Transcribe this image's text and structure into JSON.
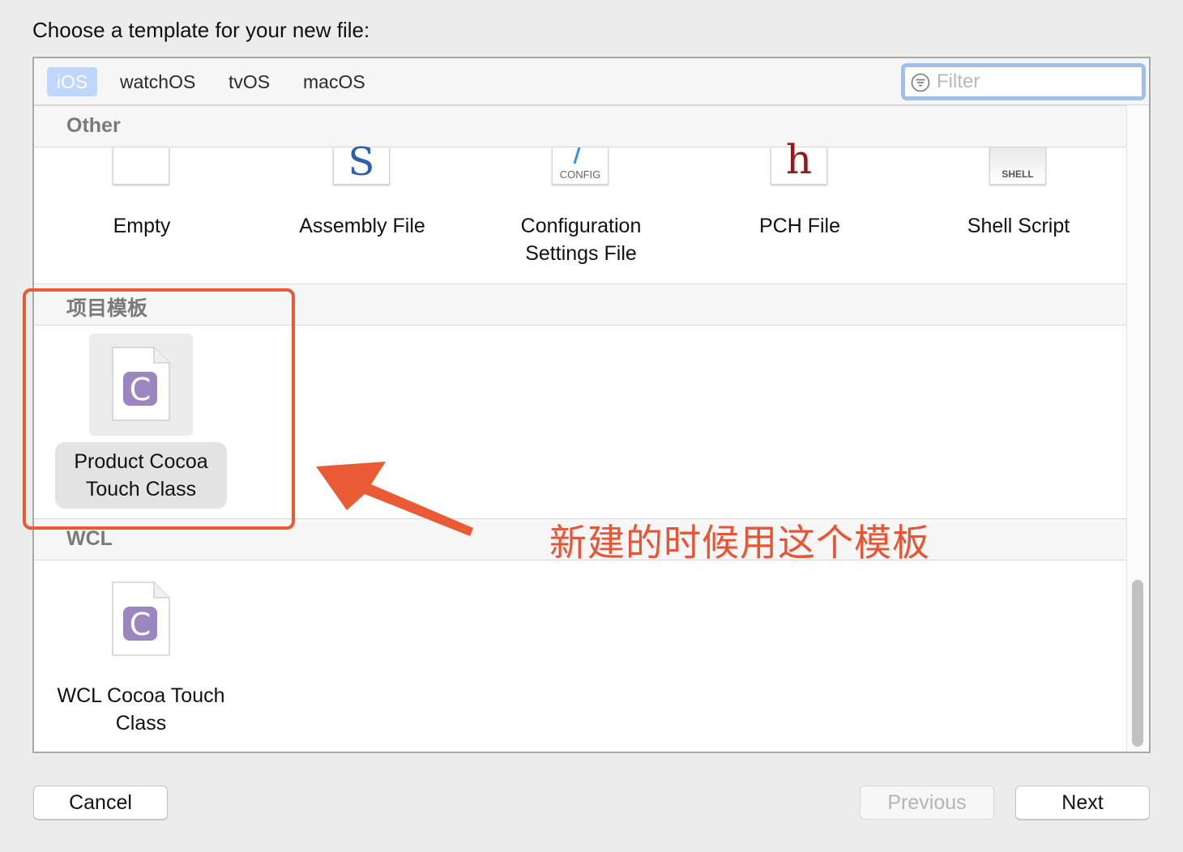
{
  "prompt": "Choose a template for your new file:",
  "tabs": [
    {
      "label": "iOS",
      "active": true
    },
    {
      "label": "watchOS",
      "active": false
    },
    {
      "label": "tvOS",
      "active": false
    },
    {
      "label": "macOS",
      "active": false
    }
  ],
  "filter": {
    "placeholder": "Filter",
    "value": ""
  },
  "sections": {
    "other": {
      "title": "Other",
      "items": [
        {
          "label": "Empty"
        },
        {
          "label": "Assembly File",
          "glyph": "S"
        },
        {
          "label_line1": "Configuration",
          "label_line2": "Settings File",
          "glyph": "CONFIG"
        },
        {
          "label": "PCH File",
          "glyph": "h"
        },
        {
          "label": "Shell Script",
          "glyph": "SHELL"
        }
      ]
    },
    "project_templates": {
      "title": "项目模板",
      "items": [
        {
          "label_line1": "Product Cocoa",
          "label_line2": "Touch Class",
          "glyph": "C",
          "selected": true
        }
      ]
    },
    "wcl": {
      "title": "WCL",
      "items": [
        {
          "label_line1": "WCL Cocoa Touch",
          "label_line2": "Class",
          "glyph": "C"
        }
      ]
    }
  },
  "buttons": {
    "cancel": "Cancel",
    "previous": "Previous",
    "next": "Next"
  },
  "annotation": {
    "text": "新建的时候用这个模板",
    "color": "#e85534"
  },
  "colors": {
    "accent_tab": "#bfd7fb",
    "filter_focus": "#9cc0f2",
    "cocoa_icon": "#9b86c0",
    "pch_glyph": "#8d1c1c",
    "assembly_glyph": "#2f5fb0"
  }
}
